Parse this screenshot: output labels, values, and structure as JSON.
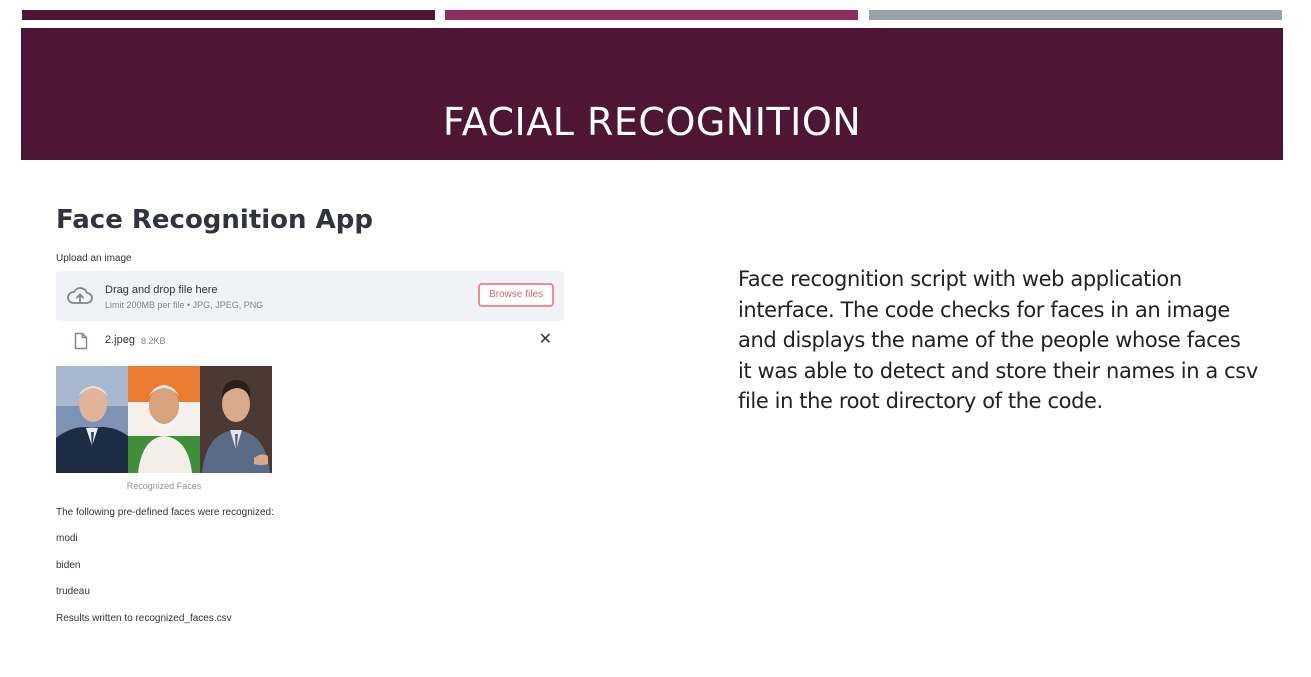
{
  "slide": {
    "title": "FACIAL RECOGNITION",
    "description": "Face recognition script with web application interface. The code checks for faces in an image and displays the name of the people whose faces it was able to detect and store their names in a csv file in the root directory of the code."
  },
  "colors": {
    "band": "#4f1535",
    "accent_bar_1": "#4f1535",
    "accent_bar_2": "#8e2d5e",
    "accent_bar_3": "#9aa0a8",
    "button_border": "#f08c8c",
    "button_text": "#e06666"
  },
  "app": {
    "title": "Face Recognition App",
    "upload_label": "Upload an image",
    "dropzone": {
      "icon": "cloud-upload-icon",
      "main_text": "Drag and drop file here",
      "sub_text": "Limit 200MB per file • JPG, JPEG, PNG",
      "browse_label": "Browse files"
    },
    "uploaded_file": {
      "icon": "file-icon",
      "name": "2.jpeg",
      "size": "8.2KB",
      "remove_icon": "close-icon",
      "remove_glyph": "✕"
    },
    "image_caption": "Recognized Faces",
    "result_heading": "The following pre-defined faces were recognized:",
    "recognized": [
      "modi",
      "biden",
      "trudeau"
    ],
    "result_footer": "Results written to recognized_faces.csv"
  }
}
